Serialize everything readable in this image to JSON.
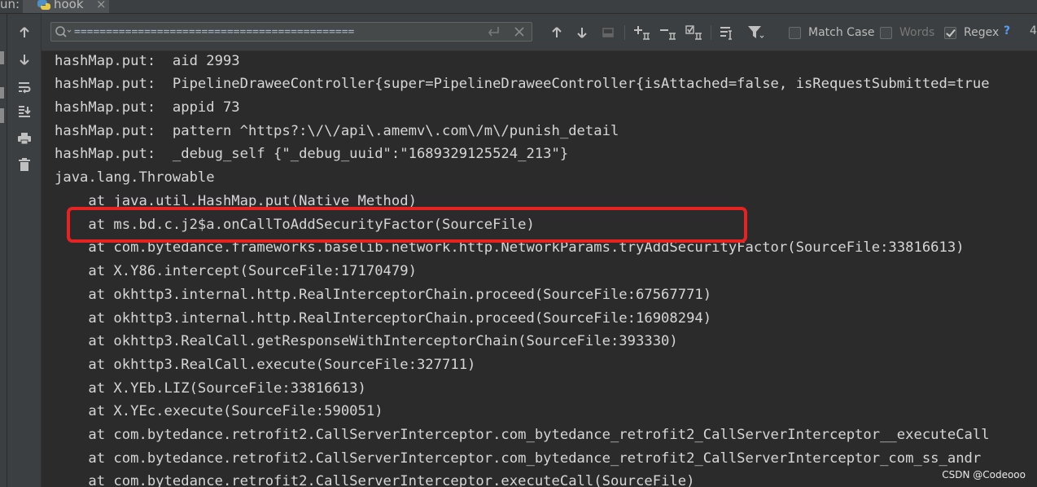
{
  "window": {
    "run_label": "un:",
    "tab_label": "hook",
    "tab_close": "×"
  },
  "search": {
    "query": "============================================",
    "enter_icon": "enter-icon",
    "clear_icon": "close-icon"
  },
  "options": {
    "match_case": {
      "label": "Match Case",
      "checked": false
    },
    "words": {
      "label": "Words",
      "checked": false
    },
    "regex": {
      "label": "Regex",
      "checked": true
    },
    "help": "?",
    "count": "4"
  },
  "console": {
    "lines": [
      "hashMap.put:  aid 2993",
      "hashMap.put:  PipelineDraweeController{super=PipelineDraweeController{isAttached=false, isRequestSubmitted=true",
      "hashMap.put:  appid 73",
      "hashMap.put:  pattern ^https?:\\/\\/api\\.amemv\\.com\\/m\\/punish_detail",
      "hashMap.put:  _debug_self {\"_debug_uuid\":\"1689329125524_213\"}",
      "java.lang.Throwable",
      "    at java.util.HashMap.put(Native Method)",
      "    at ms.bd.c.j2$a.onCallToAddSecurityFactor(SourceFile)",
      "    at com.bytedance.frameworks.baselib.network.http.NetworkParams.tryAddSecurityFactor(SourceFile:33816613)",
      "    at X.Y86.intercept(SourceFile:17170479)",
      "    at okhttp3.internal.http.RealInterceptorChain.proceed(SourceFile:67567771)",
      "    at okhttp3.internal.http.RealInterceptorChain.proceed(SourceFile:16908294)",
      "    at okhttp3.RealCall.getResponseWithInterceptorChain(SourceFile:393330)",
      "    at okhttp3.RealCall.execute(SourceFile:327711)",
      "    at X.YEb.LIZ(SourceFile:33816613)",
      "    at X.YEc.execute(SourceFile:590051)",
      "    at com.bytedance.retrofit2.CallServerInterceptor.com_bytedance_retrofit2_CallServerInterceptor__executeCall",
      "    at com.bytedance.retrofit2.CallServerInterceptor.com_bytedance_retrofit2_CallServerInterceptor_com_ss_andr",
      "    at com.bytedance.retrofit2.CallServerInterceptor.executeCall(SourceFile)"
    ],
    "highlighted_line_index": 7
  },
  "watermark": "CSDN @Codeooo",
  "colors": {
    "background": "#2b2b2b",
    "panel": "#3c3f41",
    "console_text": "#d6d6d6",
    "highlight_border": "#e52323",
    "accent": "#589df6"
  }
}
